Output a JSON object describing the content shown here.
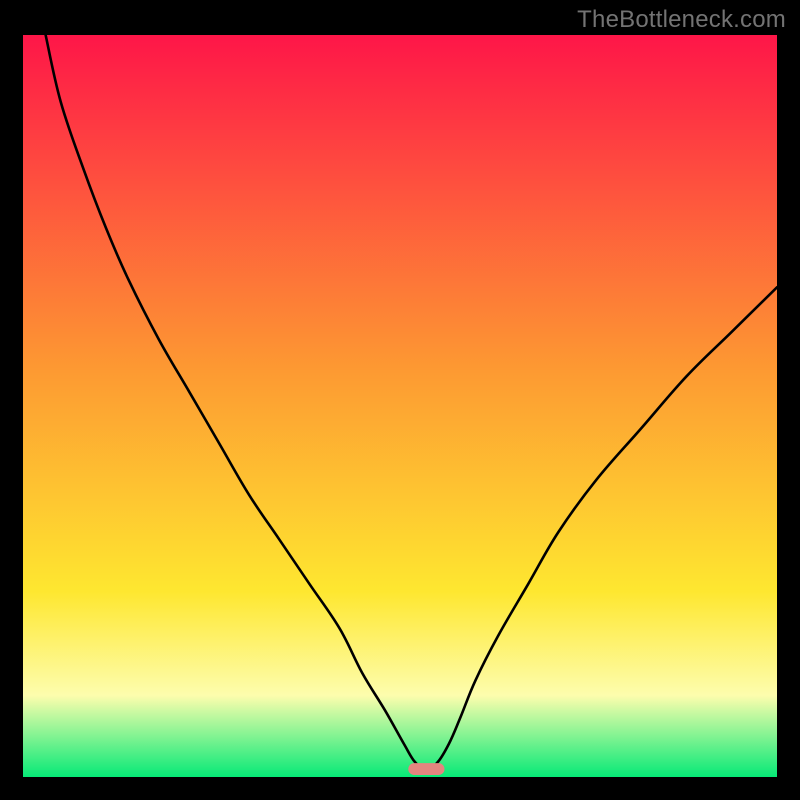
{
  "watermark": "TheBottleneck.com",
  "chart_data": {
    "type": "line",
    "title": "",
    "xlabel": "",
    "ylabel": "",
    "xlim": [
      0,
      100
    ],
    "ylim": [
      0,
      100
    ],
    "grid": false,
    "legend": false,
    "background_gradient": {
      "top": "#fe1648",
      "mid_upper": "#fd9932",
      "mid": "#fee730",
      "mid_lower": "#fdfdad",
      "bottom": "#06e977"
    },
    "series": [
      {
        "name": "bottleneck-curve",
        "color": "#000000",
        "x": [
          3,
          5,
          8,
          11,
          14,
          18,
          22,
          26,
          30,
          34,
          38,
          42,
          45,
          48,
          50.5,
          52,
          53.5,
          55,
          56.5,
          58,
          60,
          63,
          67,
          71,
          76,
          82,
          88,
          94,
          100
        ],
        "y": [
          100,
          91,
          82,
          74,
          67,
          59,
          52,
          45,
          38,
          32,
          26,
          20,
          14,
          9,
          4.5,
          2.0,
          1.0,
          2.0,
          4.5,
          8,
          13,
          19,
          26,
          33,
          40,
          47,
          54,
          60,
          66
        ]
      }
    ],
    "marker": {
      "name": "optimal-point",
      "x": 53.5,
      "width": 4.8,
      "height": 1.6,
      "color": "#e4857f"
    }
  }
}
